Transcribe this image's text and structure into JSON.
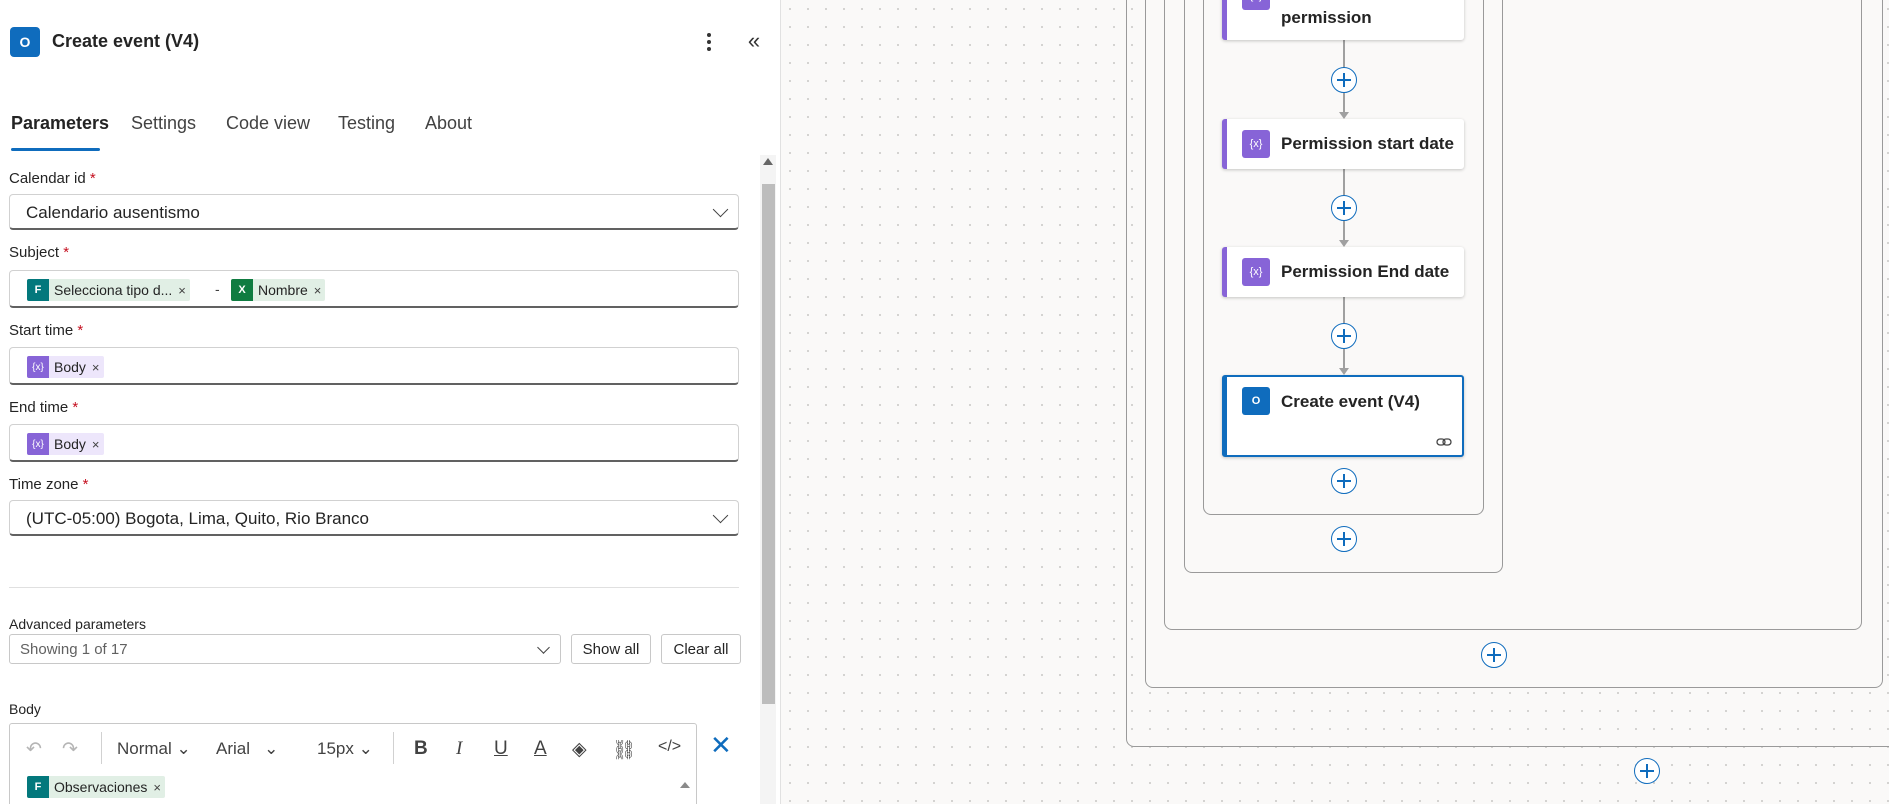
{
  "panel": {
    "title": "Create event (V4)",
    "header_icon": "outlook-icon",
    "tabs": [
      {
        "label": "Parameters",
        "active": true
      },
      {
        "label": "Settings"
      },
      {
        "label": "Code view"
      },
      {
        "label": "Testing"
      },
      {
        "label": "About"
      }
    ],
    "fields": {
      "calendar_id": {
        "label": "Calendar id",
        "required": "*",
        "value": "Calendario ausentismo"
      },
      "subject": {
        "label": "Subject",
        "required": "*",
        "tokens": [
          {
            "text": "Selecciona tipo d...",
            "icon": "forms-icon"
          },
          {
            "text": "Nombre",
            "icon": "excel-icon"
          }
        ],
        "separator": "-"
      },
      "start_time": {
        "label": "Start time",
        "required": "*",
        "token": "Body"
      },
      "end_time": {
        "label": "End time",
        "required": "*",
        "token": "Body"
      },
      "time_zone": {
        "label": "Time zone",
        "required": "*",
        "value": "(UTC-05:00) Bogota, Lima, Quito, Rio Branco"
      }
    },
    "advanced": {
      "label": "Advanced parameters",
      "value": "Showing 1 of 17",
      "show_all": "Show all",
      "clear_all": "Clear all"
    },
    "body": {
      "label": "Body",
      "toolbar": {
        "style": "Normal",
        "font": "Arial",
        "size": "15px"
      },
      "token": "Observaciones"
    },
    "token_close": "×"
  },
  "canvas": {
    "nodes": [
      {
        "title": "permission"
      },
      {
        "title": "Permission start date"
      },
      {
        "title": "Permission End date"
      },
      {
        "title": "Create event (V4)",
        "selected": true
      }
    ]
  },
  "colors": {
    "accent": "#0f6cbd",
    "variable": "#8764d7",
    "excel": "#107c41",
    "forms": "#03787c",
    "required": "#c50f1f"
  }
}
